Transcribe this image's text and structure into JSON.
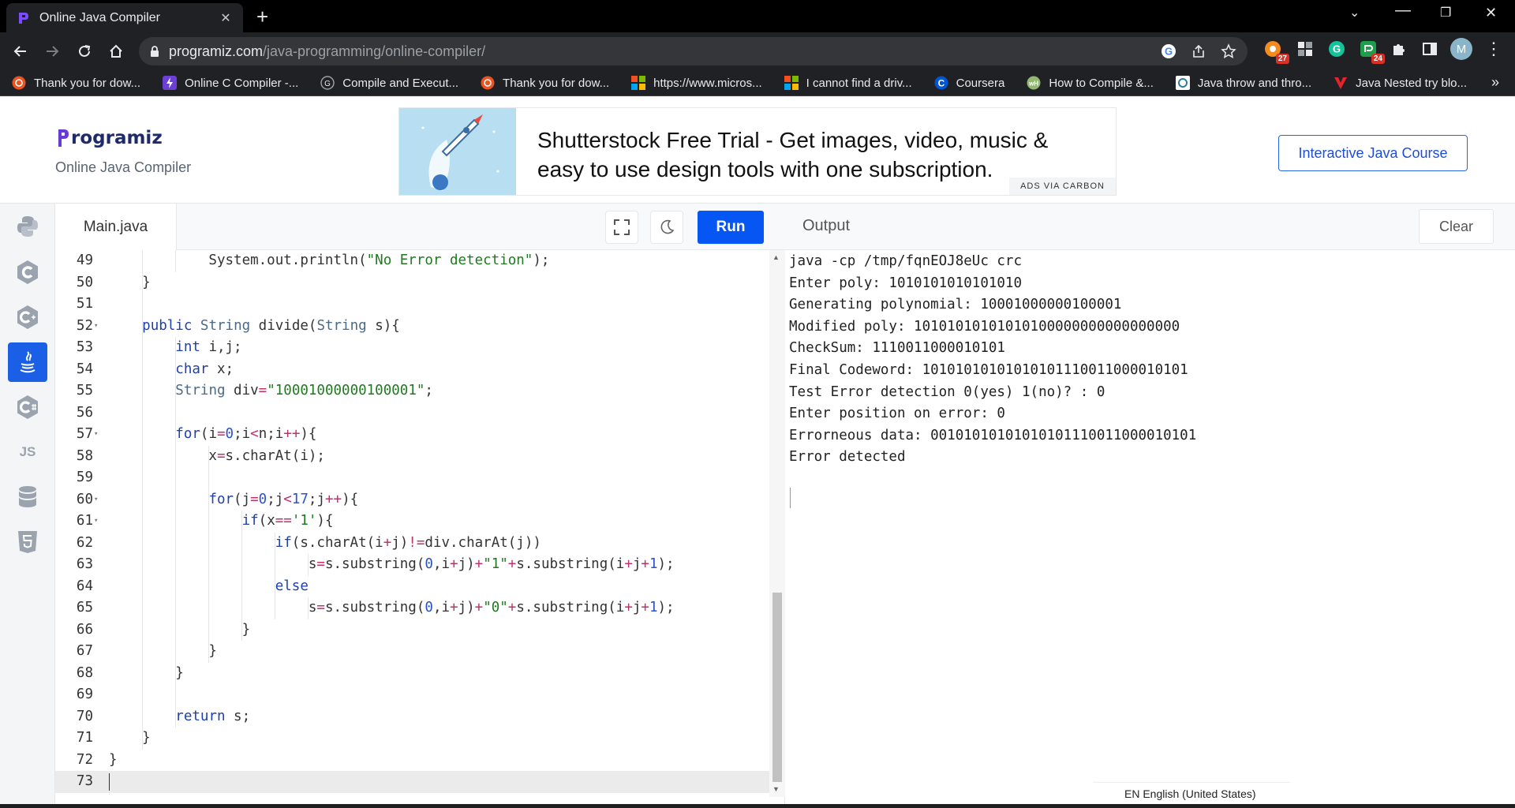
{
  "browser": {
    "tab_title": "Online Java Compiler",
    "url_host": "programiz.com",
    "url_path": "/java-programming/online-compiler/",
    "ext_badges": [
      "27",
      "24"
    ],
    "profile_initial": "M",
    "bookmarks": [
      "Thank you for dow...",
      "Online C Compiler -...",
      "Compile and Execut...",
      "Thank you for dow...",
      "https://www.micros...",
      "I cannot find a driv...",
      "Coursera",
      "How to Compile &...",
      "Java throw and thro...",
      "Java Nested try blo..."
    ],
    "more": "»"
  },
  "site": {
    "logo_text": "rogramiz",
    "subtitle": "Online Java Compiler",
    "ad_text": "Shutterstock Free Trial - Get images, video, music & easy to use design tools with one subscription.",
    "ad_label": "ADS VIA CARBON",
    "course_button": "Interactive Java Course"
  },
  "sidebar": {
    "js_label": "JS",
    "items": [
      "python-icon",
      "c-icon",
      "cpp-icon",
      "java-icon",
      "csharp-icon",
      "js-icon",
      "database-icon",
      "html5-icon"
    ]
  },
  "editor": {
    "file_tab": "Main.java",
    "run_label": "Run",
    "line_numbers": [
      "49",
      "50",
      "51",
      "52",
      "53",
      "54",
      "55",
      "56",
      "57",
      "58",
      "59",
      "60",
      "61",
      "62",
      "63",
      "64",
      "65",
      "66",
      "67",
      "68",
      "69",
      "70",
      "71",
      "72",
      "73"
    ]
  },
  "output": {
    "title": "Output",
    "clear_label": "Clear",
    "lines": [
      "java -cp /tmp/fqnEOJ8eUc crc",
      "Enter poly: 1010101010101010",
      "Generating polynomial: 10001000000100001",
      "Modified poly: 10101010101010100000000000000000",
      "CheckSum: 1110011000010101",
      "Final Codeword: 10101010101010101110011000010101",
      "Test Error detection 0(yes) 1(no)? : 0",
      "Enter position on error: 0",
      "Errorneous data: 00101010101010101110011000010101",
      "Error detected"
    ]
  },
  "status": {
    "language": "EN English (United States)"
  },
  "colors": {
    "run_button": "#0556f3",
    "sidebar_active": "#1a5fe6",
    "brand_purple": "#6b39d6"
  }
}
